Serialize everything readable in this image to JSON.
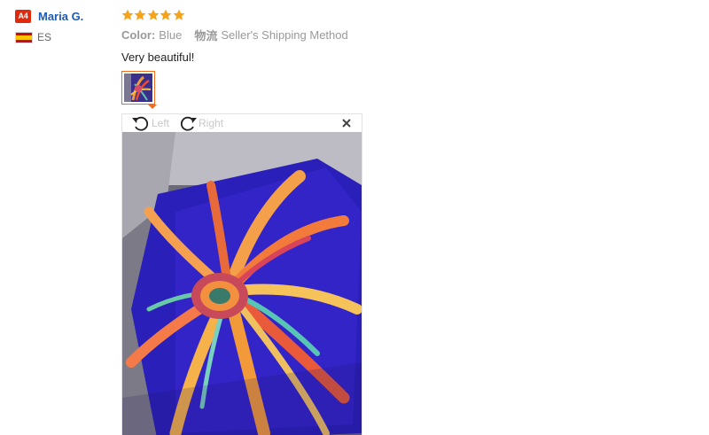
{
  "reviewer": {
    "level_badge": "A4",
    "name": "Maria G.",
    "country_code": "ES",
    "flag_icon": "spain-flag-icon"
  },
  "review": {
    "rating": 5,
    "star_color": "#f5a318",
    "attributes": [
      {
        "key": "Color:",
        "value": "Blue"
      },
      {
        "key": "物流",
        "value": "Seller's Shipping Method"
      }
    ],
    "text": "Very beautiful!"
  },
  "viewer": {
    "rotate_left_label": "Left",
    "rotate_right_label": "Right",
    "rotate_left_icon": "rotate-left-icon",
    "rotate_right_icon": "rotate-right-icon",
    "close_icon": "close-icon",
    "accent_color": "#f06c1e"
  }
}
